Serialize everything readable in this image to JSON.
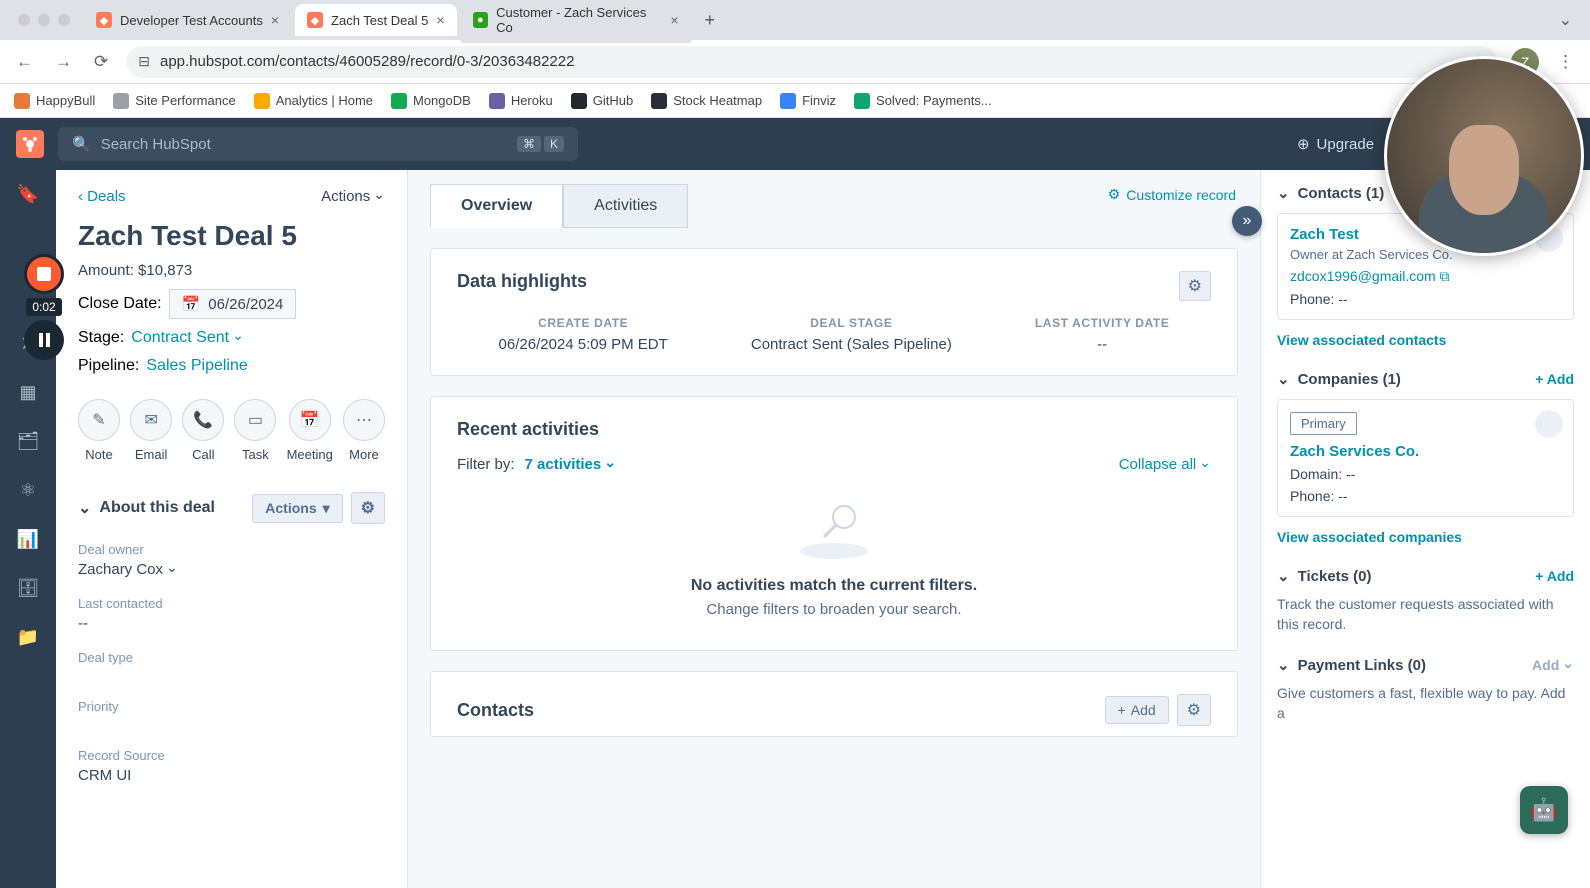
{
  "browser": {
    "tabs": [
      {
        "title": "Developer Test Accounts",
        "favicon_color": "#ff7a59"
      },
      {
        "title": "Zach Test Deal 5",
        "favicon_color": "#ff7a59",
        "active": true
      },
      {
        "title": "Customer - Zach Services Co",
        "favicon_color": "#2ca01c"
      }
    ],
    "url": "app.hubspot.com/contacts/46005289/record/0-3/20363482222",
    "profile_initial": "Z",
    "bookmarks": [
      {
        "label": "HappyBull"
      },
      {
        "label": "Site Performance"
      },
      {
        "label": "Analytics | Home"
      },
      {
        "label": "MongoDB"
      },
      {
        "label": "Heroku"
      },
      {
        "label": "GitHub"
      },
      {
        "label": "Stock Heatmap"
      },
      {
        "label": "Finviz"
      },
      {
        "label": "Solved: Payments..."
      }
    ]
  },
  "hubspot": {
    "search_placeholder": "Search HubSpot",
    "kbd1": "⌘",
    "kbd2": "K",
    "upgrade": "Upgrade"
  },
  "recording": {
    "time": "0:02"
  },
  "left": {
    "back": "Deals",
    "actions": "Actions",
    "title": "Zach Test Deal 5",
    "amount_label": "Amount:",
    "amount_value": "$10,873",
    "close_label": "Close Date:",
    "close_value": "06/26/2024",
    "stage_label": "Stage:",
    "stage_value": "Contract Sent",
    "pipeline_label": "Pipeline:",
    "pipeline_value": "Sales Pipeline",
    "actions_buttons": {
      "note": "Note",
      "email": "Email",
      "call": "Call",
      "task": "Task",
      "meeting": "Meeting",
      "more": "More"
    },
    "about_title": "About this deal",
    "about_actions": "Actions",
    "fields": {
      "owner_label": "Deal owner",
      "owner_value": "Zachary Cox",
      "last_label": "Last contacted",
      "last_value": "--",
      "type_label": "Deal type",
      "priority_label": "Priority",
      "source_label": "Record Source",
      "source_value": "CRM UI"
    }
  },
  "mid": {
    "customize": "Customize record",
    "tab_overview": "Overview",
    "tab_activities": "Activities",
    "highlights_title": "Data highlights",
    "highlights": {
      "create_label": "CREATE DATE",
      "create_value": "06/26/2024 5:09 PM EDT",
      "stage_label": "DEAL STAGE",
      "stage_value": "Contract Sent (Sales Pipeline)",
      "last_label": "LAST ACTIVITY DATE",
      "last_value": "--"
    },
    "recent_title": "Recent activities",
    "filter_label": "Filter by:",
    "filter_value": "7 activities",
    "collapse_all": "Collapse all",
    "empty_strong": "No activities match the current filters.",
    "empty_sub": "Change filters to broaden your search.",
    "contacts_title": "Contacts",
    "add_btn": "Add"
  },
  "right": {
    "contacts_header": "Contacts (1)",
    "add": "+ Add",
    "contact": {
      "name": "Zach Test",
      "role": "Owner at Zach Services Co.",
      "email": "zdcox1996@gmail.com",
      "phone": "Phone: --"
    },
    "view_contacts": "View associated contacts",
    "companies_header": "Companies (1)",
    "primary": "Primary",
    "company": {
      "name": "Zach Services Co.",
      "domain": "Domain: --",
      "phone": "Phone: --"
    },
    "view_companies": "View associated companies",
    "tickets_header": "Tickets (0)",
    "tickets_text": "Track the customer requests associated with this record.",
    "payments_header": "Payment Links (0)",
    "payments_add": "Add",
    "payments_text": "Give customers a fast, flexible way to pay. Add a"
  }
}
